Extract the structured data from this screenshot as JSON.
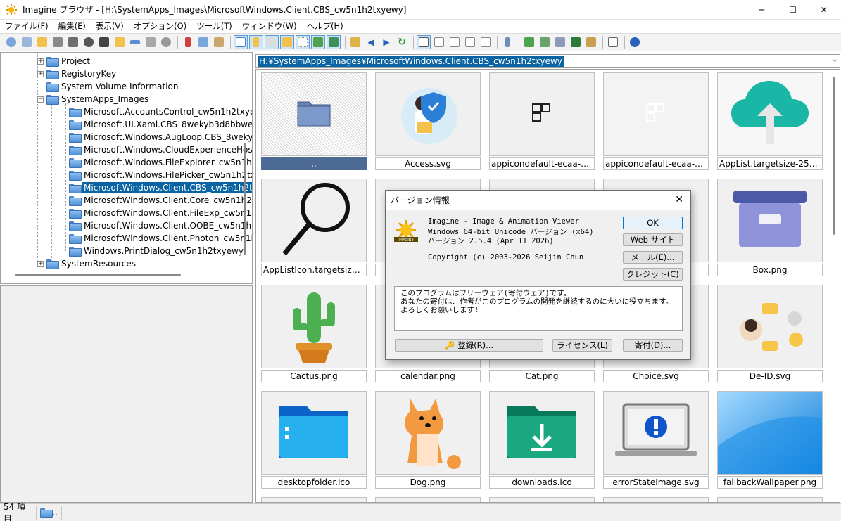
{
  "window": {
    "title": "Imagine ブラウザ - [H:\\SystemApps_Images\\MicrosoftWindows.Client.CBS_cw5n1h2txyewy]",
    "minimize": "─",
    "maximize": "☐",
    "close": "✕"
  },
  "menu": [
    "ファイル(F)",
    "編集(E)",
    "表示(V)",
    "オプション(O)",
    "ツール(T)",
    "ウィンドウ(W)",
    "ヘルプ(H)"
  ],
  "tree": {
    "items": [
      {
        "label": "Project",
        "expander": "+"
      },
      {
        "label": "RegistoryKey",
        "expander": "+"
      },
      {
        "label": "System Volume Information",
        "expander": ""
      },
      {
        "label": "SystemApps_Images",
        "expander": "−"
      },
      {
        "label": "Microsoft.AccountsControl_cw5n1h2txye",
        "expander": ""
      },
      {
        "label": "Microsoft.UI.Xaml.CBS_8wekyb3d8bbwe",
        "expander": ""
      },
      {
        "label": "Microsoft.Windows.AugLoop.CBS_8weky",
        "expander": ""
      },
      {
        "label": "Microsoft.Windows.CloudExperienceHost",
        "expander": ""
      },
      {
        "label": "Microsoft.Windows.FileExplorer_cw5n1h2",
        "expander": ""
      },
      {
        "label": "Microsoft.Windows.FilePicker_cw5n1h2tx",
        "expander": ""
      },
      {
        "label": "MicrosoftWindows.Client.CBS_cw5n1h2tx",
        "expander": "",
        "selected": true
      },
      {
        "label": "MicrosoftWindows.Client.Core_cw5n1h2t",
        "expander": ""
      },
      {
        "label": "MicrosoftWindows.Client.FileExp_cw5n1h",
        "expander": ""
      },
      {
        "label": "MicrosoftWindows.Client.OOBE_cw5n1h2",
        "expander": ""
      },
      {
        "label": "MicrosoftWindows.Client.Photon_cw5n1h",
        "expander": ""
      },
      {
        "label": "Windows.PrintDialog_cw5n1h2txyewy",
        "expander": ""
      },
      {
        "label": "SystemResources",
        "expander": "+"
      }
    ]
  },
  "path": "H:¥SystemApps_Images¥MicrosoftWindows.Client.CBS_cw5n1h2txyewy",
  "thumbnails": [
    {
      "caption": "..",
      "icon": "folder-icon"
    },
    {
      "caption": "Access.svg",
      "icon": "access-person-shield-icon"
    },
    {
      "caption": "appicondefault-ecaa-32....",
      "icon": "app-grid-dark-icon"
    },
    {
      "caption": "appicondefault-ecaa-32-i...",
      "icon": "app-grid-light-icon"
    },
    {
      "caption": "AppList.targetsize-256_alt...",
      "icon": "cloud-upload-icon"
    },
    {
      "caption": "AppListIcon.targetsize-25...",
      "icon": "magnifier-icon"
    },
    {
      "caption": "a",
      "icon": "partial-icon"
    },
    {
      "caption": "",
      "icon": "partial-icon"
    },
    {
      "caption": "",
      "icon": "partial-icon"
    },
    {
      "caption": "Box.png",
      "icon": "box-icon"
    },
    {
      "caption": "Cactus.png",
      "icon": "cactus-icon"
    },
    {
      "caption": "calendar.png",
      "icon": "calendar-icon"
    },
    {
      "caption": "Cat.png",
      "icon": "cat-icon"
    },
    {
      "caption": "Choice.svg",
      "icon": "choice-icon"
    },
    {
      "caption": "De-ID.svg",
      "icon": "de-id-icon"
    },
    {
      "caption": "desktopfolder.ico",
      "icon": "desktop-folder-icon"
    },
    {
      "caption": "Dog.png",
      "icon": "dog-icon"
    },
    {
      "caption": "downloads.ico",
      "icon": "downloads-folder-icon"
    },
    {
      "caption": "errorStateImage.svg",
      "icon": "error-laptop-icon"
    },
    {
      "caption": "fallbackWallpaper.png",
      "icon": "wallpaper-icon"
    }
  ],
  "status": {
    "count": "54 項目",
    "folder": ".."
  },
  "dialog": {
    "title": "バージョン情報",
    "close": "✕",
    "line1": "Imagine - Image & Animation Viewer",
    "line2": "Windows 64-bit Unicode バージョン (x64)",
    "line3": "バージョン 2.5.4 (Apr 11 2026)",
    "copyright": "Copyright (c) 2003-2026 Seijin Chun",
    "buttons": {
      "ok": "OK",
      "web": "Web サイト",
      "mail": "メール(E)...",
      "credit": "クレジット(C)"
    },
    "message": [
      "このプログラムはフリーウェア(寄付ウェア)です。",
      "あなたの寄付は、作者がこのプログラムの開発を継続するのに大いに役立ちます。",
      "よろしくお願いします!"
    ],
    "register": "登録(R)...",
    "license": "ライセンス(L)",
    "donate": "寄付(D)...",
    "logo_text": "IMAGINE"
  }
}
